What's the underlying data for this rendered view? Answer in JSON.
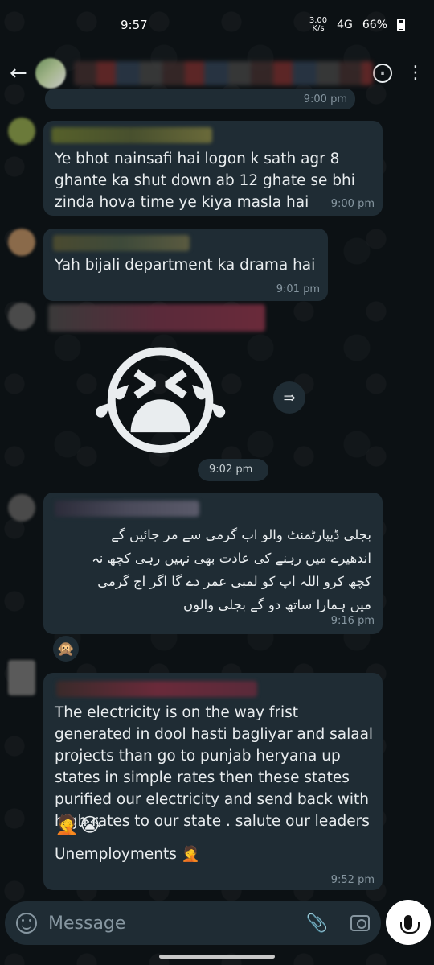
{
  "status_bar": {
    "time": "9:57",
    "net_speed": "3.00",
    "net_unit": "K/s",
    "signal": "4G",
    "battery": "66%"
  },
  "header": {
    "title": ""
  },
  "messages": [
    {
      "time": "9:00 pm"
    },
    {
      "text": "Ye bhot nainsafi hai logon k sath agr 8 ghante ka shut down ab 12 ghate se bhi zinda hova time ye kiya masla hai",
      "time": "9:00 pm"
    },
    {
      "text": "Yah bijali department ka drama hai",
      "time": "9:01 pm"
    },
    {
      "emoji": "😭",
      "time": "9:02 pm"
    },
    {
      "lines": [
        "بجلی ڈیپارٹمنٹ والو اب گرمی سے مر جائیں گے",
        "اندھیرے میں رہنے کی عادت بھی نہیں رہی کچھ نہ",
        "کچھ کرو اللہ اپ کو لمبی عمر دے گا اگر اج گرمی",
        "میں ہمارا ساتھ دو گے بجلی والوں"
      ],
      "time": "9:16 pm",
      "reaction": "🙊"
    },
    {
      "text": "The electricity is on the way frist generated in dool hasti bagliyar and salaal projects than go to punjab heryana up states in simple rates then these states purified our electricity and send back with high rates to our state . salute our leaders",
      "emojis": "🤦😭",
      "text2": "Unemployments 🤦",
      "time": "9:52 pm"
    }
  ],
  "compose": {
    "placeholder": "Message"
  },
  "colors": {
    "bubble": "#1f2c34",
    "background": "#0c1114",
    "time": "#8696a0"
  }
}
